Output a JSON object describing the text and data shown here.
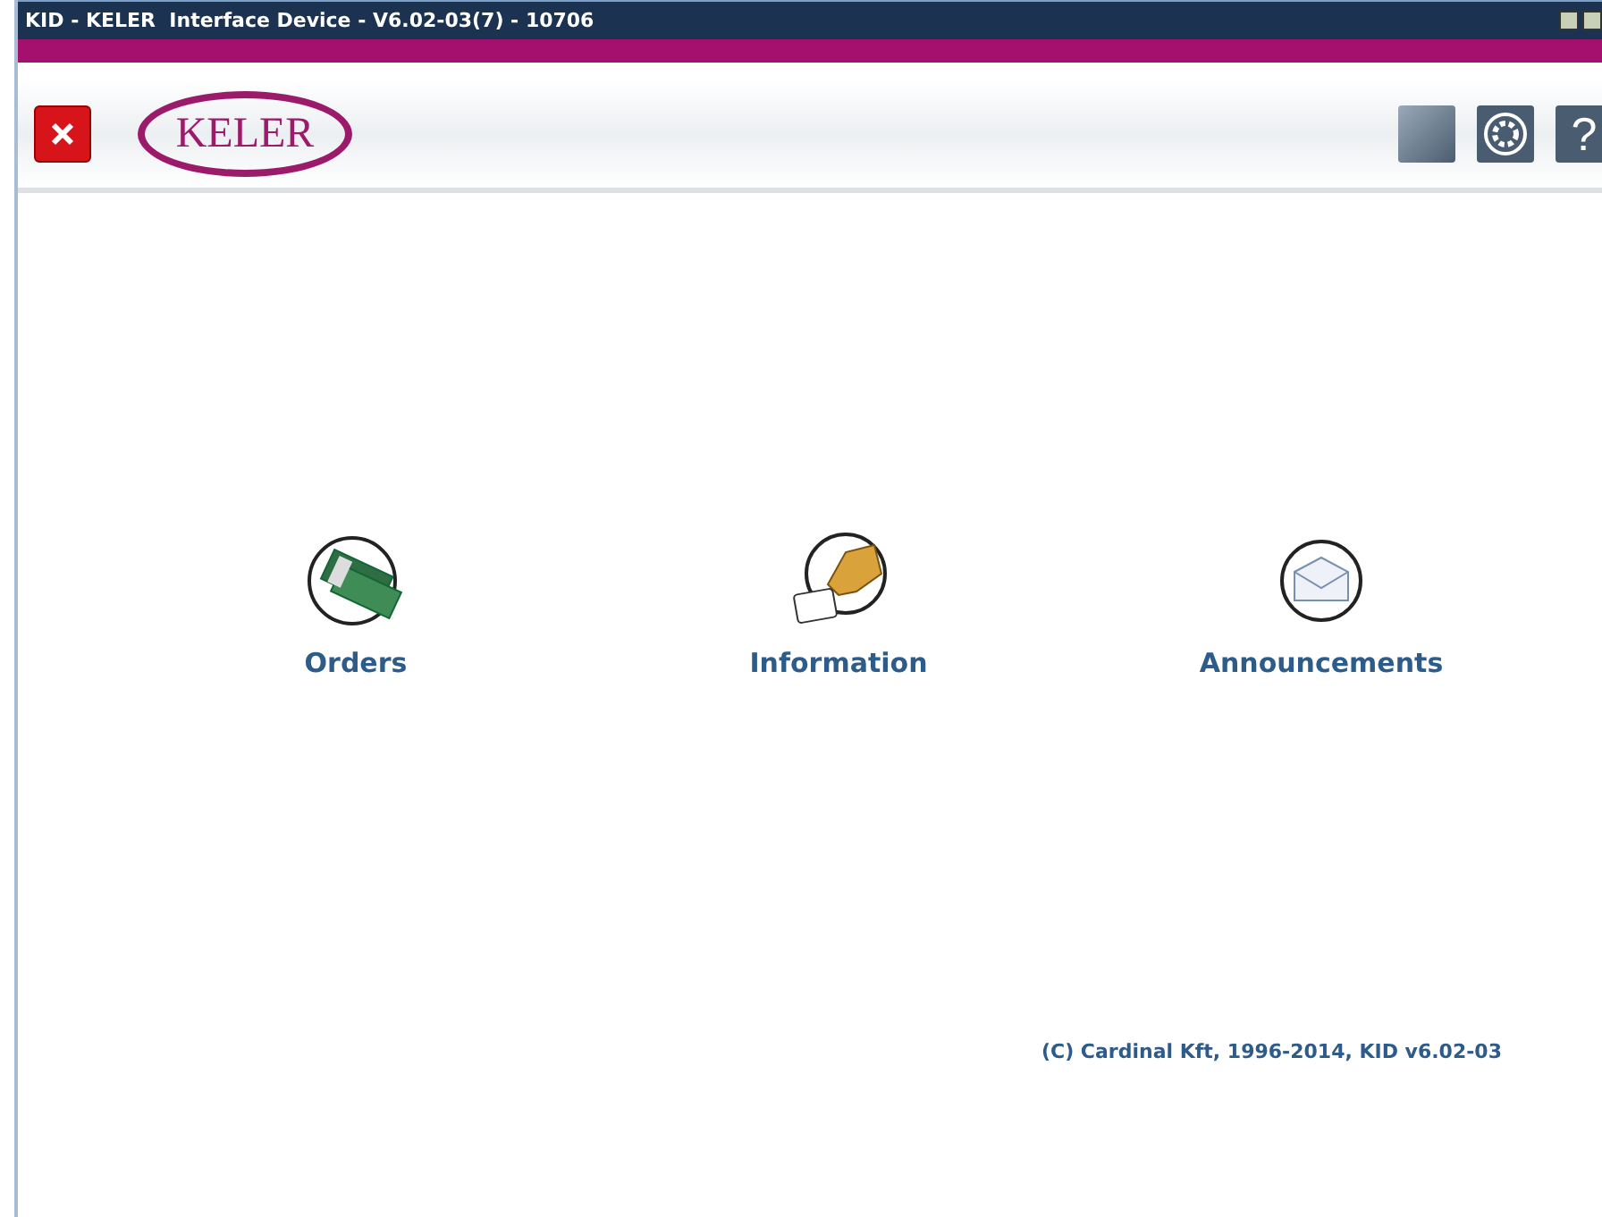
{
  "window": {
    "title": "KID - KELER  Interface Device - V6.02-03(7) - 10706"
  },
  "header": {
    "logo": "KELER",
    "help": "?"
  },
  "menu": [
    {
      "kind": "money",
      "label": "Orders"
    },
    {
      "kind": "card",
      "label": "Information"
    },
    {
      "kind": "mail",
      "label": "Announcements"
    }
  ],
  "footer": "(C) Cardinal Kft, 1996-2014, KID v6.02-03"
}
